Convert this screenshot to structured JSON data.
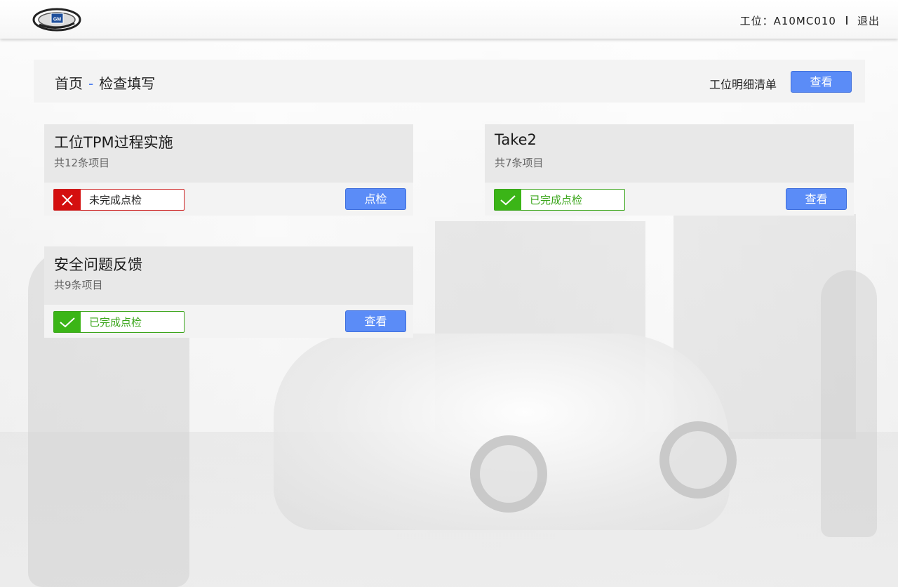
{
  "header": {
    "logo_text": "GM",
    "station_label": "工位：A10MC010",
    "logout_label": "退出"
  },
  "title_bar": {
    "home": "首页",
    "separator": "-",
    "page": "检查填写",
    "detail_label": "工位明细清单",
    "view_button": "查看"
  },
  "cards": [
    {
      "title": "工位TPM过程实施",
      "count": "共12条项目",
      "status": "未完成点检",
      "status_type": "incomplete",
      "button": "点检"
    },
    {
      "title": "Take2",
      "count": "共7条项目",
      "status": "已完成点检",
      "status_type": "complete",
      "button": "查看"
    },
    {
      "title": "安全问题反馈",
      "count": "共9条项目",
      "status": "已完成点检",
      "status_type": "complete",
      "button": "查看"
    }
  ],
  "colors": {
    "accent": "#5b8cf7",
    "incomplete": "#d40f0f",
    "complete": "#3bb517"
  }
}
